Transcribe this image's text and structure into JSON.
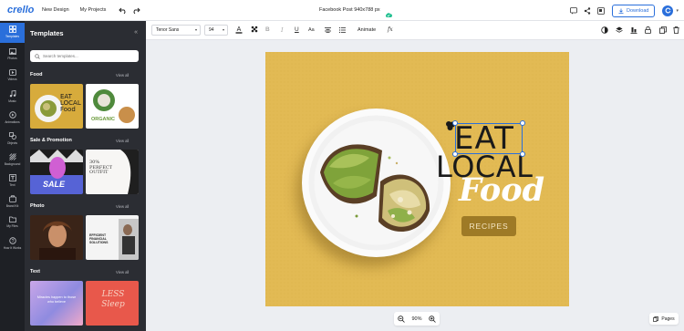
{
  "app": {
    "logo": "crello",
    "nav_new_design": "New Design",
    "nav_my_projects": "My Projects",
    "doc_title": "Facebook Post 940x788 px",
    "download_label": "Download",
    "avatar_initial": "C"
  },
  "rail": [
    {
      "label": "Templates",
      "icon": "templates-icon",
      "active": true
    },
    {
      "label": "Photos",
      "icon": "photos-icon"
    },
    {
      "label": "Videos",
      "icon": "videos-icon"
    },
    {
      "label": "Music",
      "icon": "music-icon"
    },
    {
      "label": "Animations",
      "icon": "animations-icon"
    },
    {
      "label": "Objects",
      "icon": "objects-icon"
    },
    {
      "label": "Background",
      "icon": "background-icon"
    },
    {
      "label": "Text",
      "icon": "text-icon"
    },
    {
      "label": "Brand Kit",
      "icon": "brand-kit-icon"
    },
    {
      "label": "My Files",
      "icon": "folder-icon"
    },
    {
      "label": "How It Works",
      "icon": "help-icon"
    }
  ],
  "panel": {
    "title": "Templates",
    "search_placeholder": "Search templates...",
    "sections": [
      {
        "title": "Food",
        "view_all": "View all",
        "thumb_texts": [
          "EAT LOCAL Food",
          "ORGANIC"
        ]
      },
      {
        "title": "Sale & Promotion",
        "view_all": "View all",
        "thumb_texts": [
          "SALE",
          "30% PERFECT OUTFIT"
        ]
      },
      {
        "title": "Photo",
        "view_all": "View all",
        "thumb_texts": [
          "",
          "EFFICIENT FINANCIAL SOLUTIONS"
        ]
      },
      {
        "title": "Text",
        "view_all": "View all",
        "thumb_texts": [
          "Miracles happen to those who believe",
          "LESS Sleep"
        ]
      }
    ]
  },
  "toolbar": {
    "font": "Tenor Sans",
    "size": "94",
    "animate": "Animate",
    "fx": "fx",
    "text_case": "Aa"
  },
  "canvas": {
    "headline_1": "EAT",
    "headline_2": "LOCAL",
    "script": "Food",
    "button": "RECIPES",
    "bg_color": "#e2ba54"
  },
  "zoom": {
    "level": "90%"
  },
  "pages_label": "Pages",
  "colors": {
    "accent": "#2a6fdb",
    "rail_bg": "#1e2025",
    "panel_bg": "#2b2d33"
  }
}
